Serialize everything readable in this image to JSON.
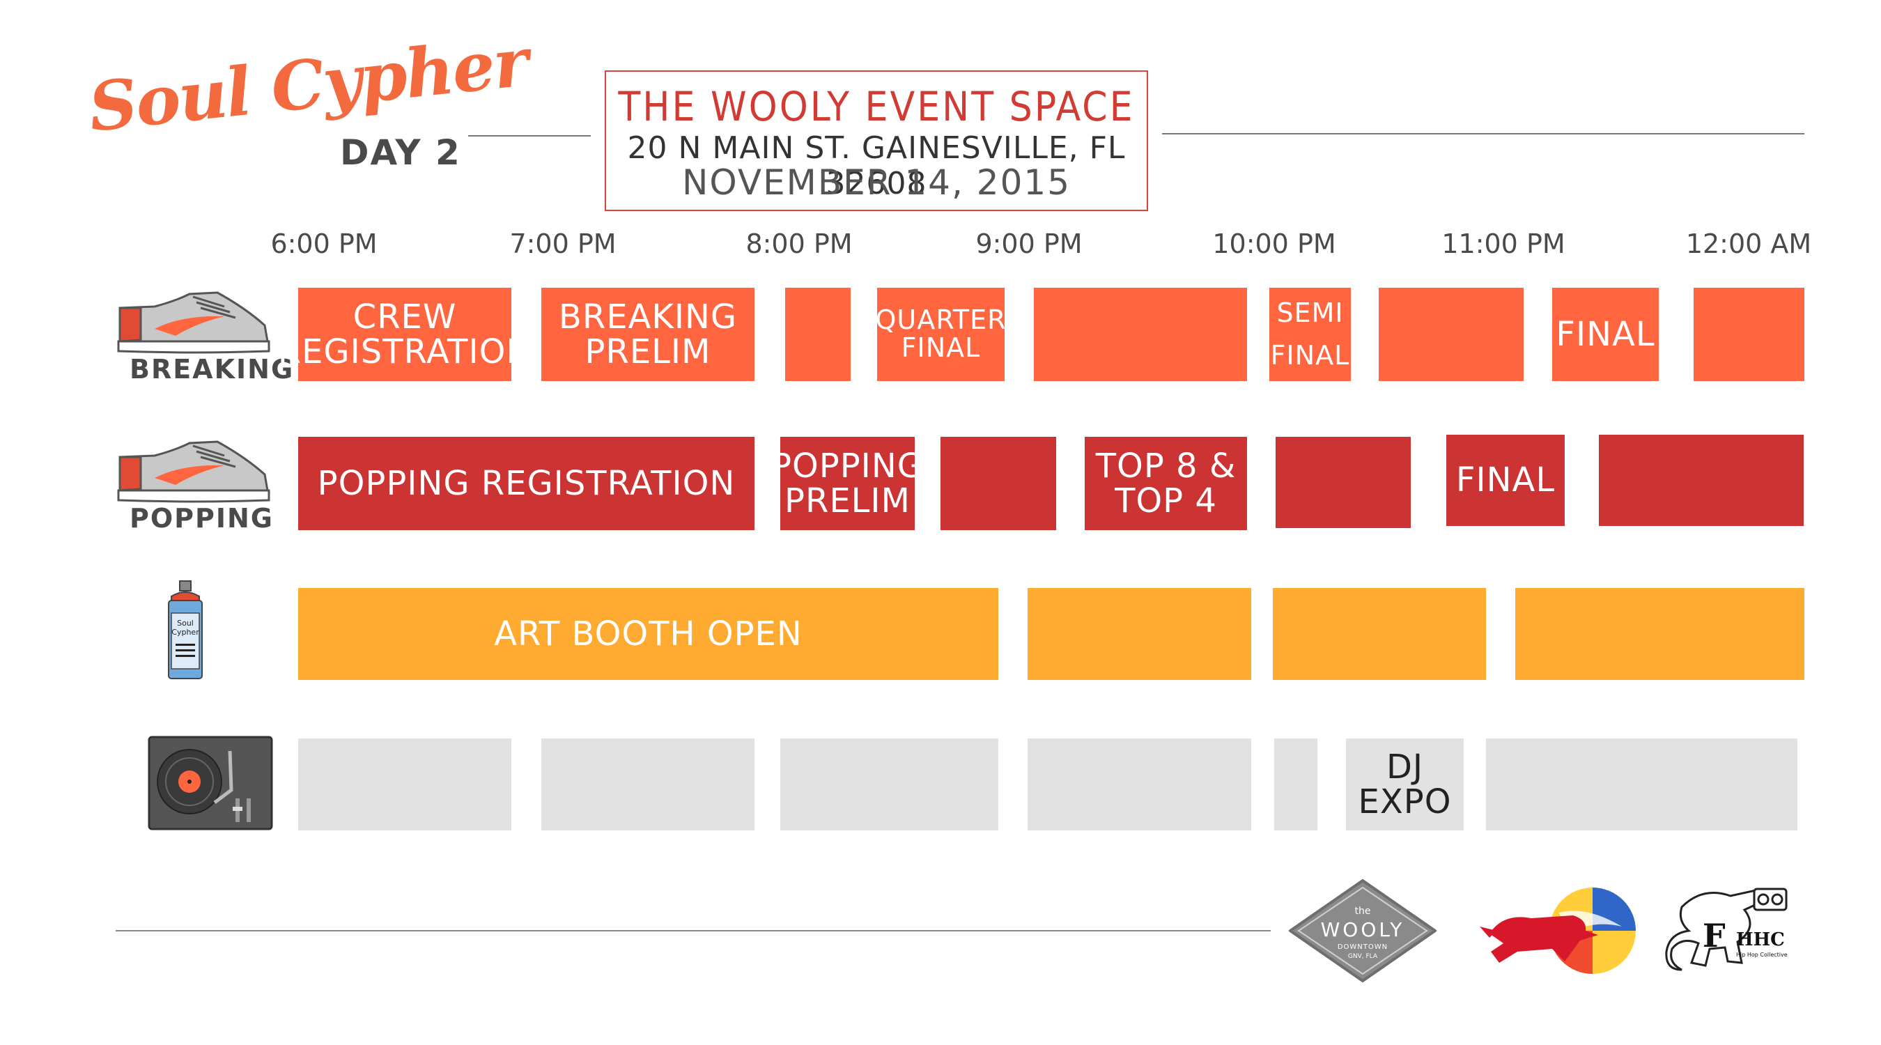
{
  "header": {
    "title": "Soul Cypher",
    "day": "DAY 2",
    "venue": {
      "name": "THE WOOLY EVENT SPACE",
      "address": "20 N MAIN ST. GAINESVILLE, FL 32608",
      "date": "NOVEMBER 14, 2015"
    }
  },
  "times": [
    "6:00 PM",
    "7:00 PM",
    "8:00 PM",
    "9:00 PM",
    "10:00 PM",
    "11:00 PM",
    "12:00 AM"
  ],
  "rows": {
    "breaking": {
      "label": "BREAKING",
      "icon": "sneaker-icon",
      "color": "#ff6640"
    },
    "popping": {
      "label": "POPPING",
      "icon": "sneaker-icon",
      "color": "#cc3333"
    },
    "art": {
      "icon": "spray-can-icon",
      "can_text": "Soul Cypher",
      "color": "#ffab31"
    },
    "dj": {
      "icon": "turntable-icon",
      "color": "#e2e2e2"
    }
  },
  "blocks": {
    "breaking": [
      "CREW\nREGISTRATION",
      "BREAKING\nPRELIM",
      "",
      "QUARTER\nFINAL",
      "",
      "SEMI\nFINAL",
      "",
      "FINAL",
      ""
    ],
    "popping": [
      "POPPING REGISTRATION",
      "POPPING\nPRELIM",
      "",
      "TOP 8 &\nTOP 4",
      "",
      "FINAL",
      ""
    ],
    "art": [
      "ART BOOTH OPEN",
      "",
      "",
      ""
    ],
    "dj": [
      "",
      "",
      "",
      "",
      "",
      "DJ\nEXPO",
      ""
    ]
  },
  "sponsors": {
    "wooly": {
      "small": "the",
      "name": "WOOLY",
      "sub": "DOWNTOWN",
      "city": "GNV, FLA"
    },
    "redbull": {
      "icon": "red-bull-logo"
    },
    "fhhc": {
      "letter": "F",
      "name": "HHC",
      "sub": "Hip Hop Collective"
    }
  }
}
